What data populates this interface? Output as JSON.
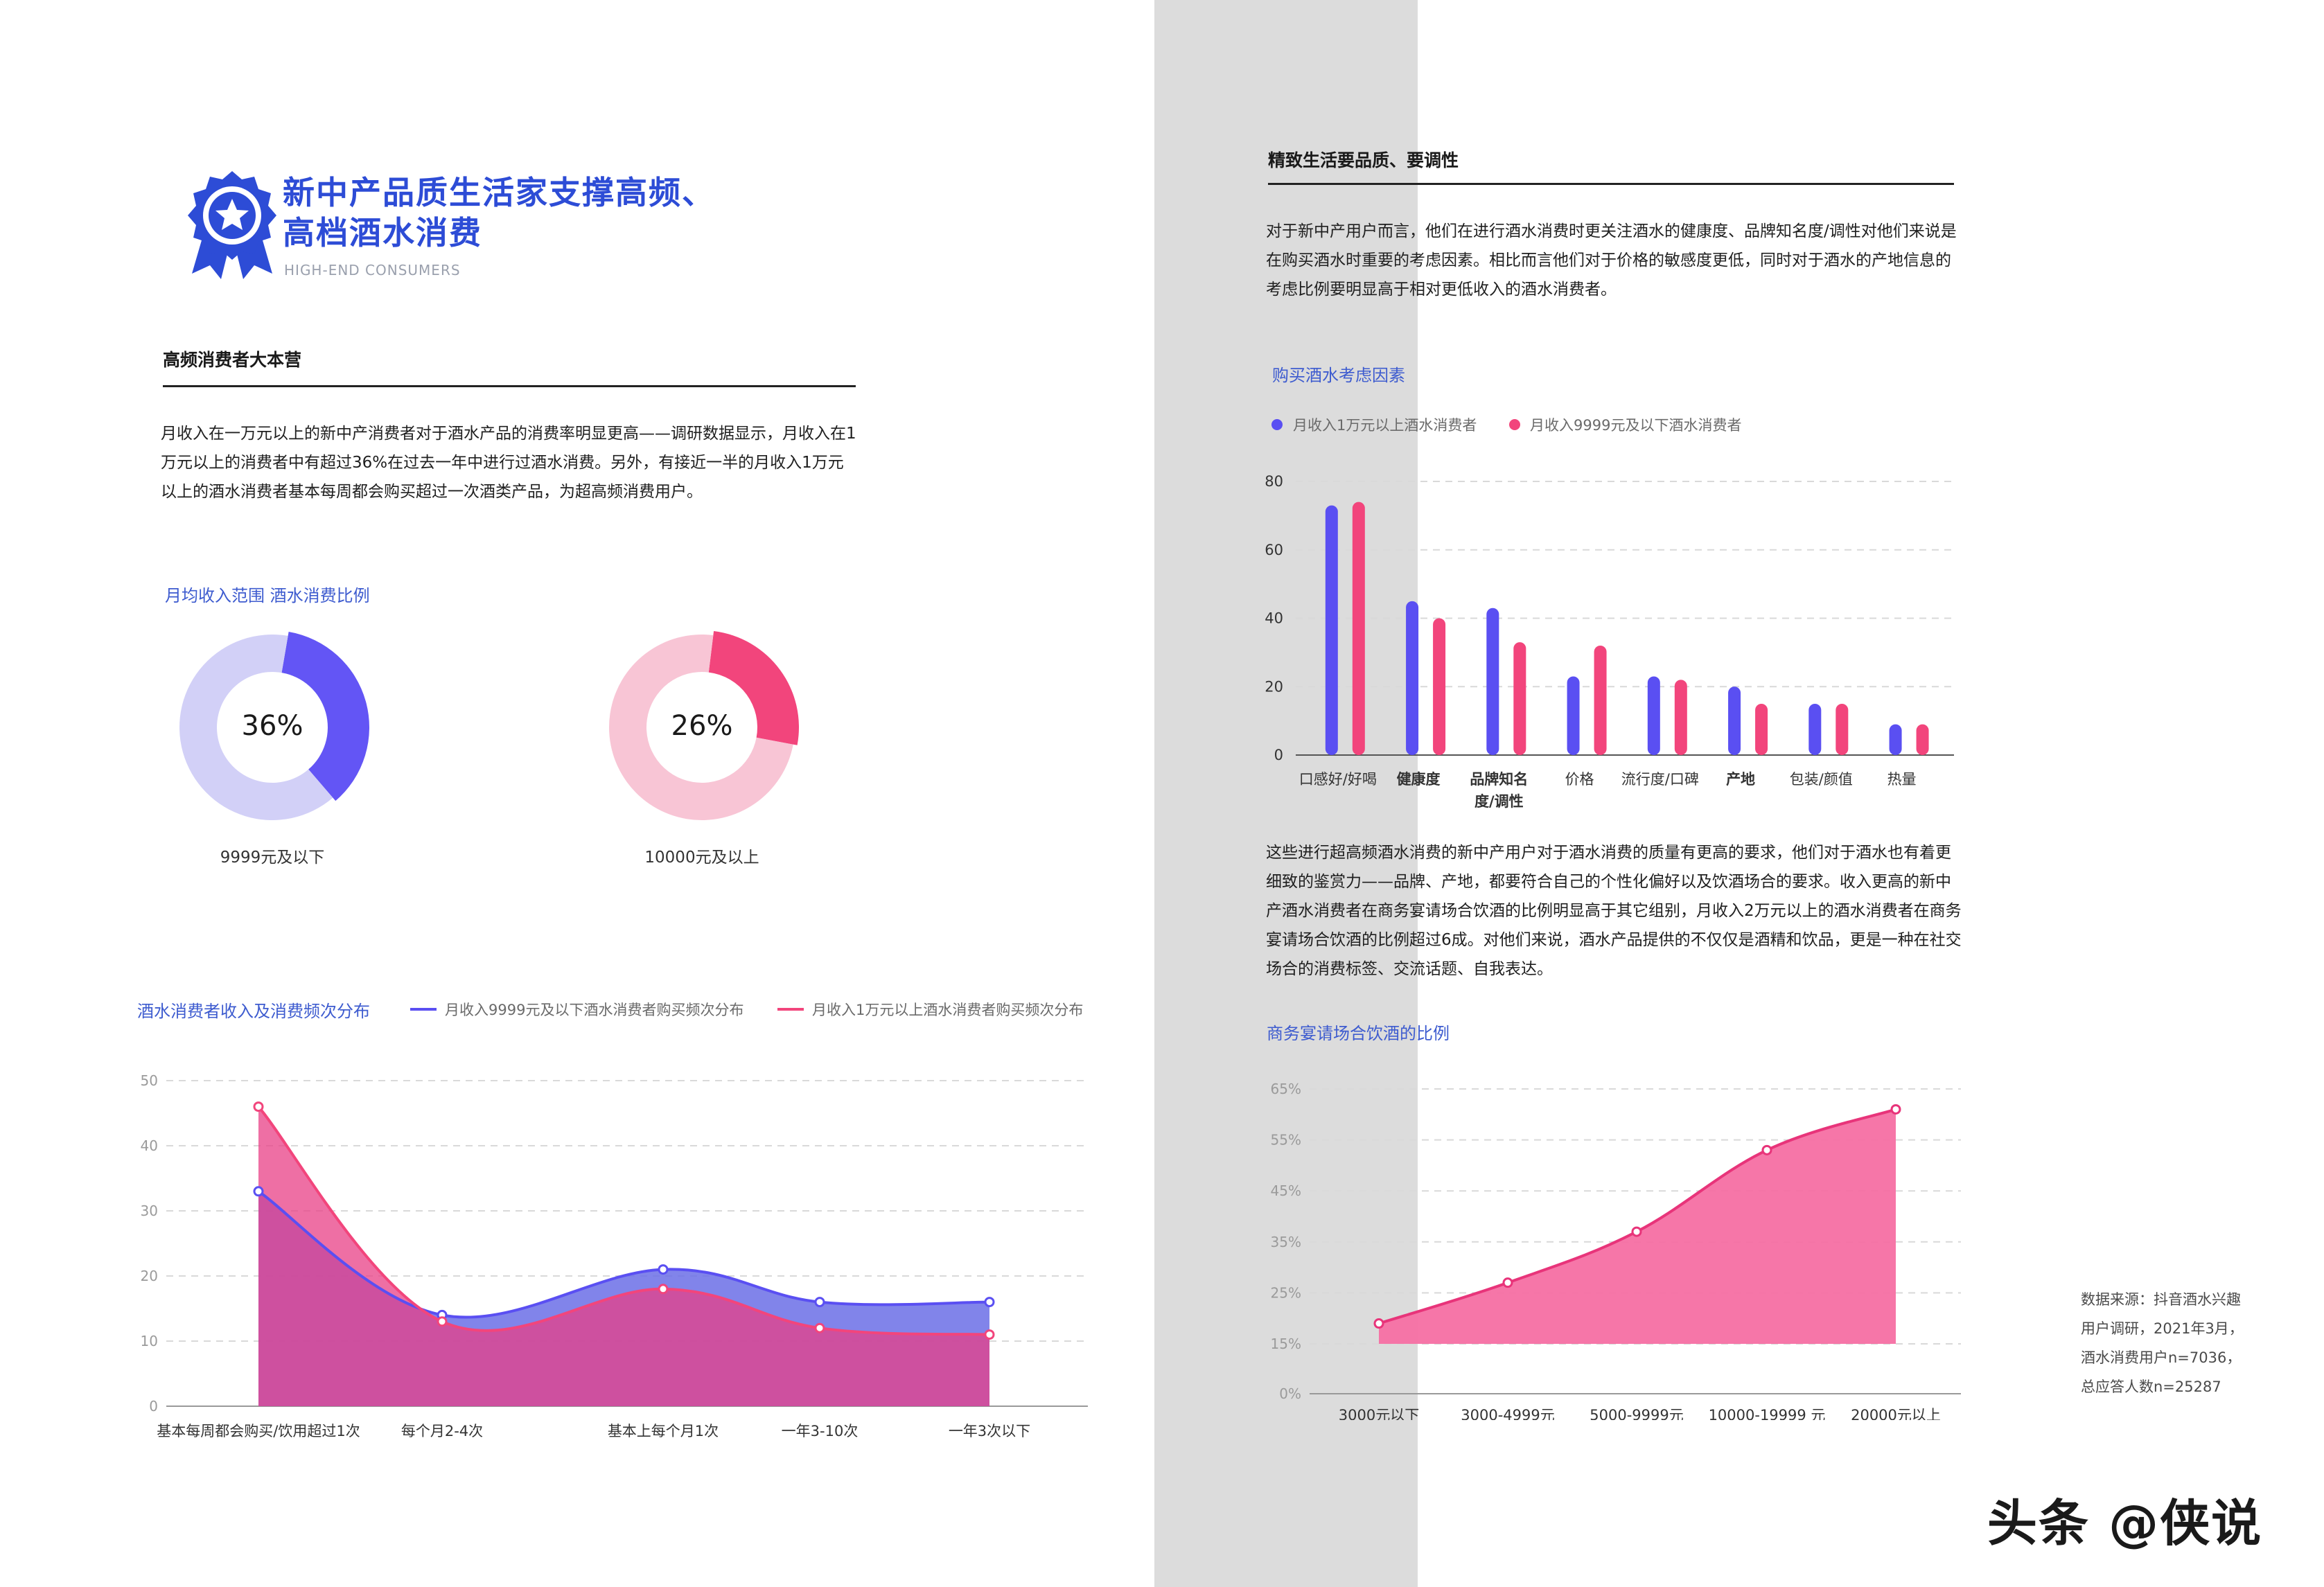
{
  "left": {
    "title_line1": "新中产品质生活家支撑高频、",
    "title_line2": "高档酒水消费",
    "subtitle": "HIGH-END CONSUMERS",
    "section_heading": "高频消费者大本营",
    "paragraph": "月收入在一万元以上的新中产消费者对于酒水产品的消费率明显更高——调研数据显示，月收入在1万元以上的消费者中有超过36%在过去一年中进行过酒水消费。另外，有接近一半的月收入1万元以上的酒水消费者基本每周都会购买超过一次酒类产品，为超高频消费用户。",
    "donut_title": "月均收入范围 酒水消费比例"
  },
  "right": {
    "section_heading": "精致生活要品质、要调性",
    "paragraph1": "对于新中产用户而言，他们在进行酒水消费时更关注酒水的健康度、品牌知名度/调性对他们来说是在购买酒水时重要的考虑因素。相比而言他们对于价格的敏感度更低，同时对于酒水的产地信息的考虑比例要明显高于相对更低收入的酒水消费者。",
    "paragraph2": "这些进行超高频酒水消费的新中产用户对于酒水消费的质量有更高的要求，他们对于酒水也有着更细致的鉴赏力——品牌、产地，都要符合自己的个性化偏好以及饮酒场合的要求。收入更高的新中产酒水消费者在商务宴请场合饮酒的比例明显高于其它组别，月收入2万元以上的酒水消费者在商务宴请场合饮酒的比例超过6成。对他们来说，酒水产品提供的不仅仅是酒精和饮品，更是一种在社交场合的消费标签、交流话题、自我表达。"
  },
  "source_lines": [
    "数据来源：抖音酒水兴趣",
    "用户调研，2021年3月，",
    "酒水消费用户n=7036，",
    "总应答人数n=25287"
  ],
  "watermark": "头条 @侠说",
  "colors": {
    "blue": "#5a4ff2",
    "pink": "#f2457c",
    "lightblue": "#d2d0f7",
    "lightpink": "#f8c5d5",
    "title": "#2d4cd6"
  },
  "chart_data": [
    {
      "type": "pie",
      "variant": "donut",
      "slices": [
        {
          "label": "36%",
          "value": 36,
          "color": "#6355f5"
        },
        {
          "label": "",
          "value": 64,
          "color": "#d2d0f7"
        }
      ],
      "center_label": "36%",
      "caption": "9999元及以下"
    },
    {
      "type": "pie",
      "variant": "donut",
      "slices": [
        {
          "label": "26%",
          "value": 26,
          "color": "#f2457c"
        },
        {
          "label": "",
          "value": 74,
          "color": "#f8c5d5"
        }
      ],
      "center_label": "26%",
      "caption": "10000元及以上"
    },
    {
      "type": "area",
      "title": "酒水消费者收入及消费频次分布",
      "categories": [
        "基本每周都会购买/饮用超过1次",
        "每个月2-4次",
        "基本上每个月1次",
        "一年3-10次",
        "一年3次以下"
      ],
      "series": [
        {
          "name": "月收入9999元及以下酒水消费者购买频次分布",
          "values": [
            33,
            14,
            21,
            16,
            16
          ],
          "color": "#5a4ff2"
        },
        {
          "name": "月收入1万元以上酒水消费者购买频次分布",
          "values": [
            46,
            13,
            18,
            12,
            11
          ],
          "color": "#f2457c"
        }
      ],
      "yticks": [
        0,
        10,
        20,
        30,
        40,
        50
      ],
      "ylim": [
        0,
        50
      ],
      "grid": true
    },
    {
      "type": "bar",
      "title": "购买酒水考虑因素",
      "categories": [
        "口感好/好喝",
        "健康度",
        "品牌知名度/调性",
        "价格",
        "流行度/口碑",
        "产地",
        "包装/颜值",
        "热量"
      ],
      "category_lines": [
        [
          "口感好/好喝"
        ],
        [
          "健康度"
        ],
        [
          "品牌知名",
          "度/调性"
        ],
        [
          "价格"
        ],
        [
          "流行度/口碑"
        ],
        [
          "产地"
        ],
        [
          "包装/颜值"
        ],
        [
          "热量"
        ]
      ],
      "bold_categories": [
        1,
        2,
        5
      ],
      "series": [
        {
          "name": "月收入1万元以上酒水消费者",
          "values": [
            73,
            45,
            43,
            23,
            23,
            20,
            15,
            9
          ],
          "color": "#5a4ff2"
        },
        {
          "name": "月收入9999元及以下酒水消费者",
          "values": [
            74,
            40,
            33,
            32,
            22,
            15,
            15,
            9
          ],
          "color": "#f2457c"
        }
      ],
      "yticks": [
        0,
        20,
        40,
        60,
        80
      ],
      "ylim": [
        0,
        80
      ],
      "legend": "top-left",
      "grid": true
    },
    {
      "type": "area",
      "title": "商务宴请场合饮酒的比例",
      "categories": [
        "3000元以下",
        "3000-4999元",
        "5000-9999元",
        "10000-19999 元",
        "20000元以上"
      ],
      "series": [
        {
          "name": "",
          "values": [
            19,
            27,
            37,
            53,
            61
          ],
          "color": "#f2457c"
        }
      ],
      "yticks": [
        "0%",
        "15%",
        "25%",
        "35%",
        "45%",
        "55%",
        "65%"
      ],
      "ylim": [
        0,
        65
      ],
      "grid": true
    }
  ]
}
